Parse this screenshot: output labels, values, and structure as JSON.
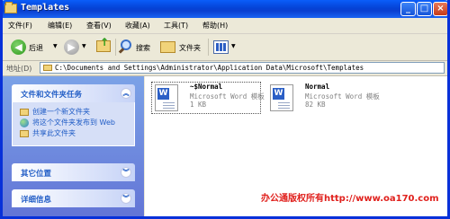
{
  "window": {
    "title": "Templates"
  },
  "menu": [
    "文件(F)",
    "编辑(E)",
    "查看(V)",
    "收藏(A)",
    "工具(T)",
    "帮助(H)"
  ],
  "toolbar": {
    "back": "后退",
    "search": "搜索",
    "folders": "文件夹"
  },
  "address": {
    "label": "地址(D)",
    "path": "C:\\Documents and Settings\\Administrator\\Application Data\\Microsoft\\Templates"
  },
  "taskpane": {
    "file_tasks": {
      "title": "文件和文件夹任务",
      "items": [
        "创建一个新文件夹",
        "将这个文件夹发布到 Web",
        "共享此文件夹"
      ]
    },
    "other_places": {
      "title": "其它位置"
    },
    "details": {
      "title": "详细信息"
    }
  },
  "files": [
    {
      "name": "~$Normal",
      "type": "Microsoft Word 模板",
      "size": "1 KB",
      "selected": true
    },
    {
      "name": "Normal",
      "type": "Microsoft Word 模板",
      "size": "82 KB",
      "selected": false
    }
  ],
  "watermark": "办公通版权所有http://www.oa170.com"
}
